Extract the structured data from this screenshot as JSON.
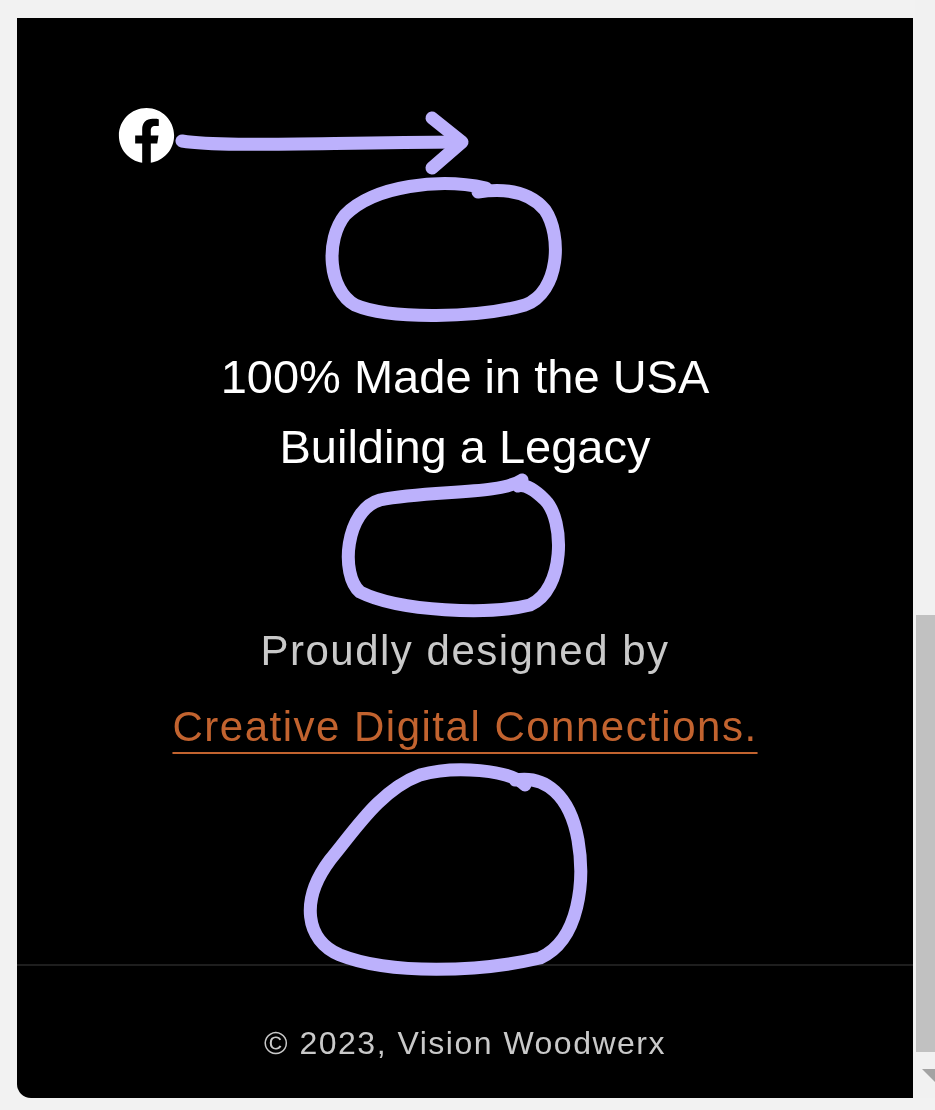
{
  "heading": {
    "lines": [
      "100% Made in the USA",
      "Building a Legacy"
    ]
  },
  "credit": {
    "text": "Proudly designed by",
    "link": "Creative Digital Connections."
  },
  "footer": {
    "copyright": "© 2023, Vision Woodwerx"
  }
}
